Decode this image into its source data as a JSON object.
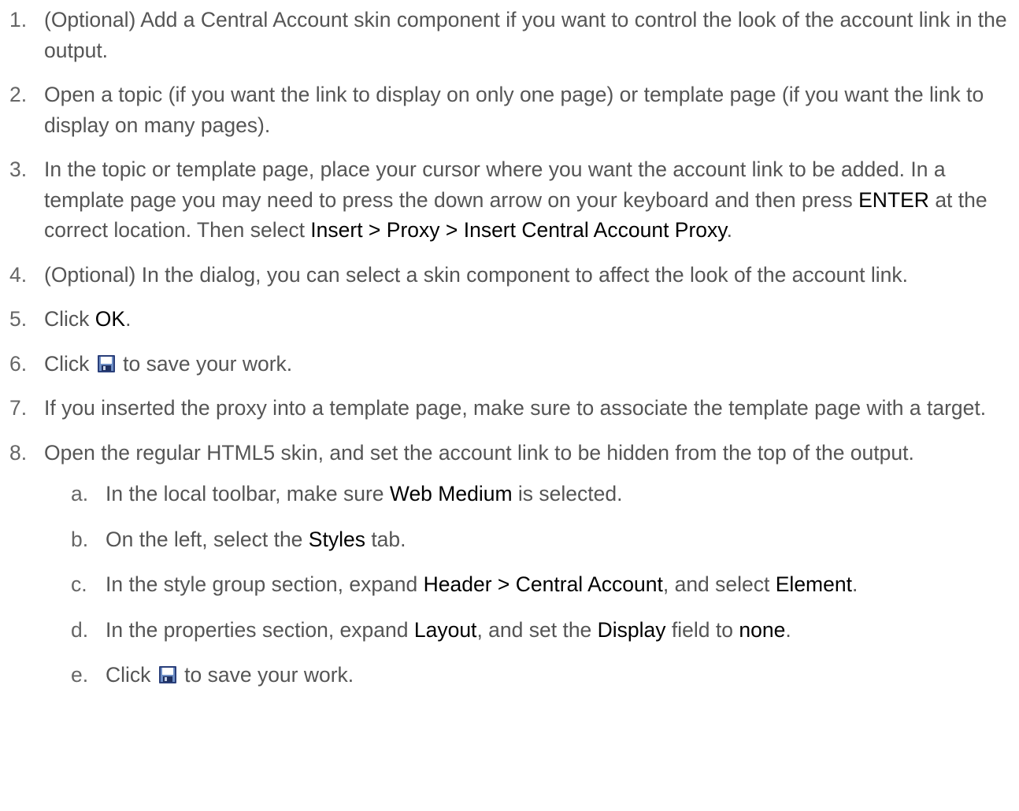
{
  "steps": [
    {
      "marker": "1.",
      "parts": [
        {
          "t": "(Optional) Add a Central Account skin component if you want to control the look of the account link in the output."
        }
      ]
    },
    {
      "marker": "2.",
      "parts": [
        {
          "t": "Open a topic (if you want the link to display on only one page) or template page (if you want the link to display on many pages)."
        }
      ]
    },
    {
      "marker": "3.",
      "parts": [
        {
          "t": "In the topic or template page, place your cursor where you want the account link to be added. In a template page you may need to press the down arrow on your keyboard and then press "
        },
        {
          "ui": "ENTER"
        },
        {
          "t": " at the correct location. Then select "
        },
        {
          "ui": "Insert > Proxy > Insert Central Account Proxy"
        },
        {
          "t": "."
        }
      ]
    },
    {
      "marker": "4.",
      "parts": [
        {
          "t": "(Optional) In the dialog, you can select a skin component to affect the look of the account link."
        }
      ]
    },
    {
      "marker": "5.",
      "parts": [
        {
          "t": "Click "
        },
        {
          "ui": "OK"
        },
        {
          "t": "."
        }
      ]
    },
    {
      "marker": "6.",
      "parts": [
        {
          "t": "Click "
        },
        {
          "icon": "save-icon"
        },
        {
          "t": " to save your work."
        }
      ]
    },
    {
      "marker": "7.",
      "parts": [
        {
          "t": "If you inserted the proxy into a template page, make sure to associate the template page with a target."
        }
      ]
    },
    {
      "marker": "8.",
      "parts": [
        {
          "t": "Open the regular HTML5 skin, and set the account link to be hidden from the top of the output."
        }
      ],
      "substeps": [
        {
          "marker": "a.",
          "parts": [
            {
              "t": "In the local toolbar, make sure "
            },
            {
              "ui": "Web Medium"
            },
            {
              "t": " is selected."
            }
          ]
        },
        {
          "marker": "b.",
          "parts": [
            {
              "t": "On the left, select the "
            },
            {
              "ui": "Styles"
            },
            {
              "t": " tab."
            }
          ]
        },
        {
          "marker": "c.",
          "parts": [
            {
              "t": "In the style group section, expand "
            },
            {
              "ui": "Header > Central Account"
            },
            {
              "t": ", and select "
            },
            {
              "ui": "Element"
            },
            {
              "t": "."
            }
          ]
        },
        {
          "marker": "d.",
          "parts": [
            {
              "t": "In the properties section, expand "
            },
            {
              "ui": "Layout"
            },
            {
              "t": ", and set the "
            },
            {
              "ui": "Display"
            },
            {
              "t": " field to "
            },
            {
              "ui": "none"
            },
            {
              "t": "."
            }
          ]
        },
        {
          "marker": "e.",
          "parts": [
            {
              "t": "Click "
            },
            {
              "icon": "save-icon"
            },
            {
              "t": " to save your work."
            }
          ]
        }
      ]
    }
  ],
  "colors": {
    "body_text": "#555555",
    "ui_text": "#000000",
    "icon_frame": "#2a3f7a"
  }
}
